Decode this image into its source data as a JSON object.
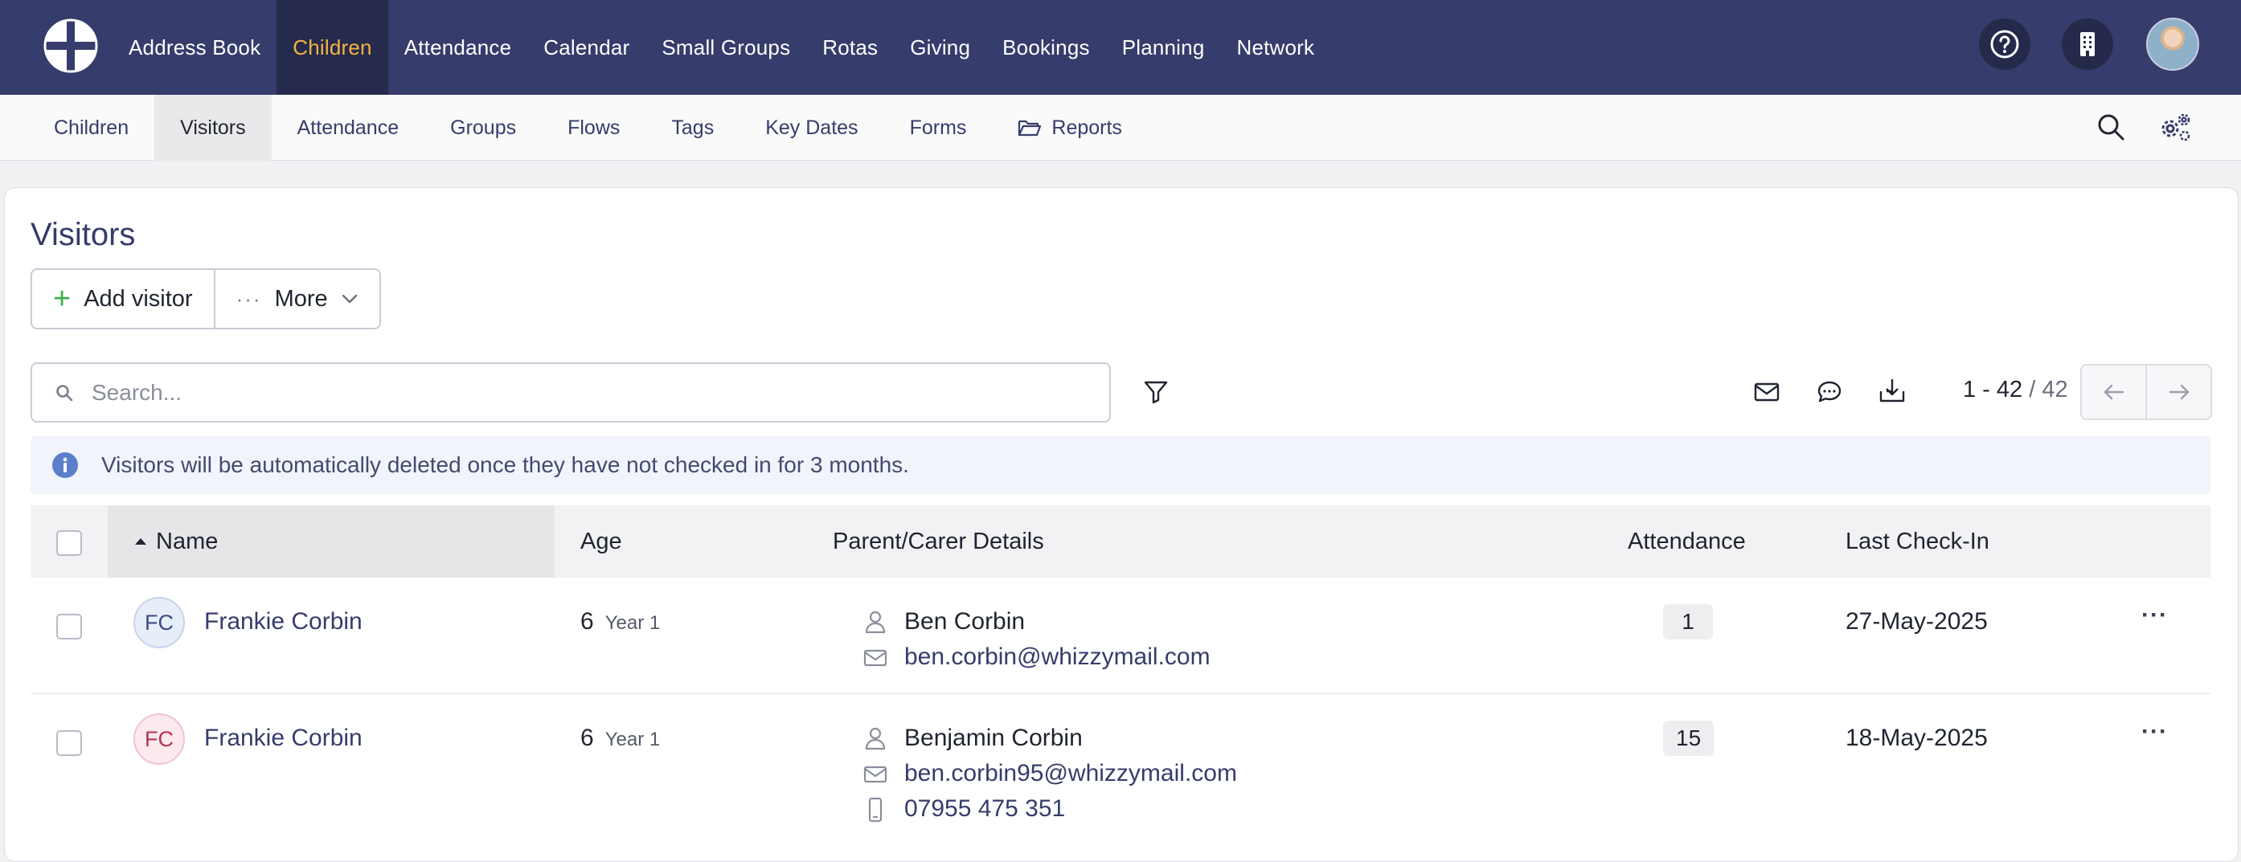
{
  "topnav": {
    "items": [
      {
        "label": "Address Book"
      },
      {
        "label": "Children",
        "active": true
      },
      {
        "label": "Attendance"
      },
      {
        "label": "Calendar"
      },
      {
        "label": "Small Groups"
      },
      {
        "label": "Rotas"
      },
      {
        "label": "Giving"
      },
      {
        "label": "Bookings"
      },
      {
        "label": "Planning"
      },
      {
        "label": "Network"
      }
    ],
    "icons": [
      "logo-icon",
      "help-icon",
      "building-icon",
      "user-avatar"
    ]
  },
  "subnav": {
    "items": [
      {
        "label": "Children"
      },
      {
        "label": "Visitors",
        "active": true
      },
      {
        "label": "Attendance"
      },
      {
        "label": "Groups"
      },
      {
        "label": "Flows"
      },
      {
        "label": "Tags"
      },
      {
        "label": "Key Dates"
      },
      {
        "label": "Forms"
      },
      {
        "label": "Reports",
        "icon": "folder-open-icon"
      }
    ],
    "icons": [
      "search-icon",
      "settings-gears-icon"
    ]
  },
  "page": {
    "title": "Visitors",
    "add_label": "Add visitor",
    "more_label": "More"
  },
  "search": {
    "placeholder": "Search...",
    "value": ""
  },
  "pagination": {
    "range": "1 - 42",
    "total": "/ 42"
  },
  "banner": {
    "text": "Visitors will be automatically deleted once they have not checked in for 3 months."
  },
  "table": {
    "columns": [
      "Name",
      "Age",
      "Parent/Carer Details",
      "Attendance",
      "Last Check-In"
    ],
    "sort_column": "Name",
    "rows": [
      {
        "initials": "FC",
        "name": "Frankie Corbin",
        "age": "6",
        "year": "Year 1",
        "parent_name": "Ben Corbin",
        "email": "ben.corbin@whizzymail.com",
        "phone": "",
        "attendance": "1",
        "last_check_in": "27-May-2025",
        "avatar_bg": "#e8eef9",
        "avatar_fg": "#3a4a8a",
        "avatar_border": "#c6d2ec"
      },
      {
        "initials": "FC",
        "name": "Frankie Corbin",
        "age": "6",
        "year": "Year 1",
        "parent_name": "Benjamin Corbin",
        "email": "ben.corbin95@whizzymail.com",
        "phone": "07955 475 351",
        "attendance": "15",
        "last_check_in": "18-May-2025",
        "avatar_bg": "#fbe9ee",
        "avatar_fg": "#b4354f",
        "avatar_border": "#f0c4cf"
      }
    ]
  },
  "colors": {
    "nav_bg": "#363c6b",
    "nav_active_bg": "#262b4d",
    "nav_active_text": "#f2b441",
    "link": "#363c6b",
    "add_icon": "#3bb04b",
    "info_icon": "#5b7fcb"
  }
}
